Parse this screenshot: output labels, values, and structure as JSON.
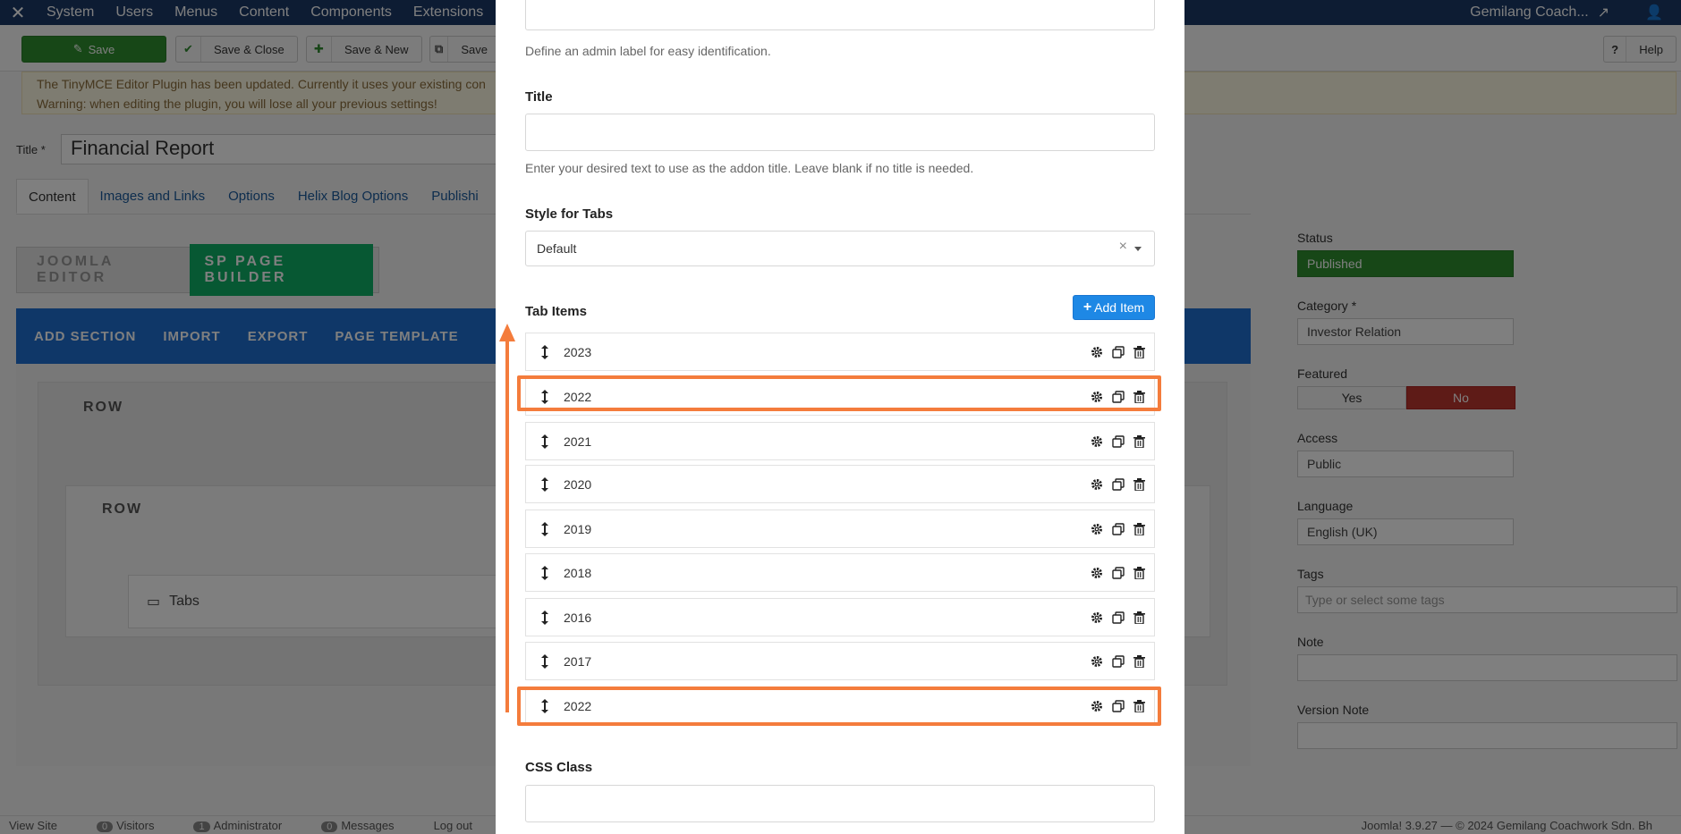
{
  "topnav": {
    "items": [
      "System",
      "Users",
      "Menus",
      "Content",
      "Components",
      "Extensions"
    ],
    "site_name": "Gemilang Coach..."
  },
  "toolbar": {
    "save": "Save",
    "save_close": "Save & Close",
    "save_new": "Save & New",
    "save_copy": "Save",
    "help": "Help"
  },
  "notice": {
    "line1": "The TinyMCE Editor Plugin has been updated. Currently it uses your existing con",
    "line2": "Warning: when editing the plugin, you will lose all your previous settings!"
  },
  "article": {
    "title_label": "Title *",
    "title_value": "Financial Report",
    "tabs": [
      "Content",
      "Images and Links",
      "Options",
      "Helix Blog Options",
      "Publishi"
    ]
  },
  "editor_switch": {
    "joomla": "JOOMLA EDITOR",
    "sppb": "SP PAGE BUILDER"
  },
  "builder": {
    "actions": [
      "ADD SECTION",
      "IMPORT",
      "EXPORT",
      "PAGE TEMPLATE"
    ],
    "row_label": "ROW",
    "inner_row_label": "ROW",
    "addon_name": "Tabs"
  },
  "sidebar": {
    "status_label": "Status",
    "status_value": "Published",
    "category_label": "Category *",
    "category_value": "Investor Relation",
    "featured_label": "Featured",
    "featured_yes": "Yes",
    "featured_no": "No",
    "access_label": "Access",
    "access_value": "Public",
    "language_label": "Language",
    "language_value": "English (UK)",
    "tags_label": "Tags",
    "tags_placeholder": "Type or select some tags",
    "note_label": "Note",
    "version_note_label": "Version Note"
  },
  "footer": {
    "view_site": "View Site",
    "visitors_count": "0",
    "visitors": "Visitors",
    "admin_count": "1",
    "admin": "Administrator",
    "messages_count": "0",
    "messages": "Messages",
    "logout": "Log out",
    "copyright": "Joomla! 3.9.27 — © 2024 Gemilang Coachwork Sdn. Bh"
  },
  "modal": {
    "admin_label_help": "Define an admin label for easy identification.",
    "title_label": "Title",
    "title_help": "Enter your desired text to use as the addon title. Leave blank if no title is needed.",
    "style_label": "Style for Tabs",
    "style_value": "Default",
    "tab_items_label": "Tab Items",
    "add_item": "Add Item",
    "items": [
      "2023",
      "2022",
      "2021",
      "2020",
      "2019",
      "2018",
      "2016",
      "2017",
      "2022"
    ],
    "css_class_label": "CSS Class"
  },
  "colors": {
    "highlight": "#f47c3c",
    "add_button": "#1e88e5"
  }
}
